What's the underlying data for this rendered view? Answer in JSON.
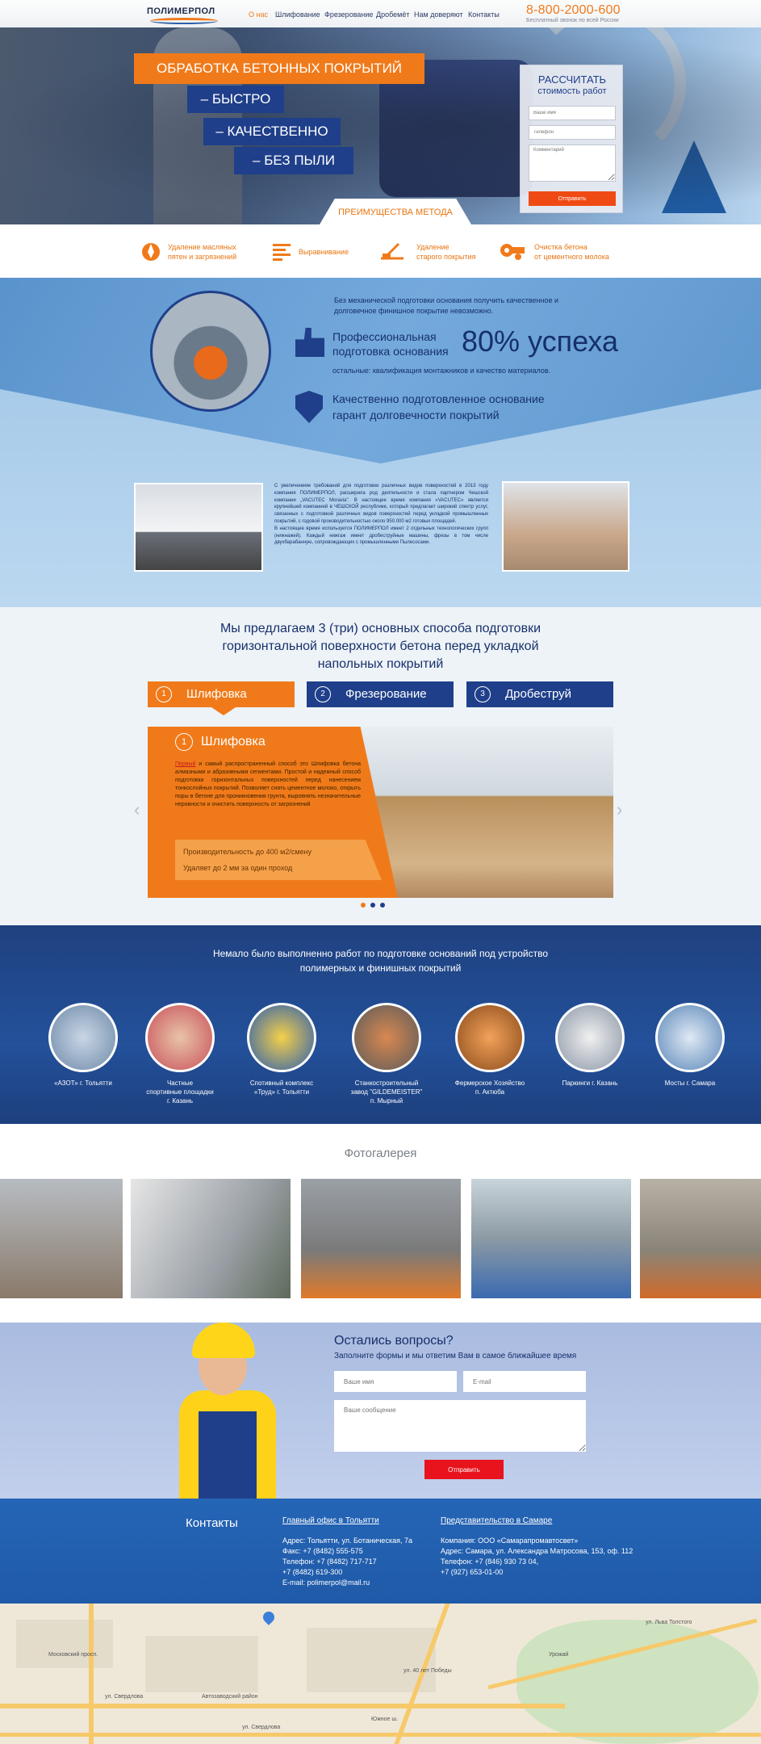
{
  "header": {
    "logo": "ПОЛИМЕРПОЛ",
    "nav": [
      "О нас",
      "Шлифование",
      "Фрезерование",
      "Дробемёт",
      "Нам доверяют",
      "Контакты"
    ],
    "phone": "8-800-2000-600",
    "phone_note": "Бесплатный звонок по всей России"
  },
  "hero": {
    "headline": "ОБРАБОТКА БЕТОННЫХ ПОКРЫТИЙ",
    "lines": [
      "– БЫСТРО",
      "– КАЧЕСТВЕННО",
      "– БЕЗ ПЫЛИ"
    ],
    "form": {
      "title": "РАССЧИТАТЬ",
      "subtitle": "стоимость работ",
      "name_placeholder": "Ваше имя",
      "phone_placeholder": "Телефон",
      "comment_placeholder": "Комментарий",
      "submit": "Отправить"
    },
    "advantages_tab": "ПРЕИМУЩЕСТВА МЕТОДА"
  },
  "features": [
    {
      "icon": "flame-icon",
      "text": "Удаление масляных\nпятен и загрязнений"
    },
    {
      "icon": "lines-icon",
      "text": "Выравнивание"
    },
    {
      "icon": "scraper-icon",
      "text": "Удаление\nстарого покрытия"
    },
    {
      "icon": "machine-icon",
      "text": "Очистка бетона\nот цементного молока"
    }
  ],
  "professional": {
    "intro": "Без механической подготовки основания получить качественное и долговечное финишное покрытие невозможно.",
    "headline": "Профессиональная\nподготовка основания",
    "percent": "80% успеха",
    "rest": "остальные: квалификация монтажников и качество материалов.",
    "guarantee": "Качественно подготовленное основание\nгарант долговечности покрытий",
    "description": "С увеличением требований для подготовки различных видов поверхностей в 2013 году компания ПОЛИМЕРПОЛ, расширила род деятельности и стала партнером Чешской компании „VACUTEC Moravia\". В настоящее время компания «VACUTEC» является крупнейшей компанией в ЧЕШСКОЙ республике, который предлагает широкий спектр услуг, связанных с подготовкой различных видов поверхностей перед укладкой промышленных покрытий, с годовой производительностью около 950.000 м2 готовых площадей.\nВ настоящее время используется ПОЛИМЕРПОЛ имеет 2 отдельных технологических групп (нижнажей). Каждый нижгаж имеет дробеструйные машины, фрезы в том числе двухбарабанную, сопровождающих с промышленными Пылесосами."
  },
  "methods": {
    "title": "Мы предлагаем 3 (три) основных способа подготовки\nгоризонтальной поверхности бетона перед укладкой\nнапольных покрытий",
    "tabs": [
      {
        "num": "1",
        "label": "Шлифовка"
      },
      {
        "num": "2",
        "label": "Фрезерование"
      },
      {
        "num": "3",
        "label": "Дробеструй"
      }
    ],
    "slide": {
      "num": "1",
      "title": "Шлифовка",
      "lead": "Первый",
      "text": " и самый распространенный способ это Шлифовка бетона алмазными и абразивными сегментами. Простой и надежный способ подготовки горизонтальных поверхностей перед нанесением тонкослойных покрытий. Позволяет снять цементное молоко, открыть поры в бетоне для проникновения грунта, выровнять незначительные неровности и очистить поверхность от загрязнений",
      "spec1": "Производительность до 400 м2/смену",
      "spec2": "Удаляет до 2 мм за один проход"
    },
    "prev": "‹",
    "next": "›"
  },
  "works": {
    "title": "Немало было выполненно работ по подготовке оснований под устройство\nполимерных и финишных покрытий",
    "items": [
      "«АЗОТ» г. Тольятти",
      "Частные\nспортивные площадки\nг. Казань",
      "Спотивный комплекс\n«Труд» г. Тольятти",
      "Станкостроительный\nзавод \"GILDEMEISTER\"\nп. Мырный",
      "Фермерское Хозяйство\nп. Актюба",
      "Паркинги г. Казань",
      "Мосты г. Самара"
    ]
  },
  "gallery": {
    "title": "Фотогалерея"
  },
  "contact": {
    "title": "Остались вопросы?",
    "subtitle": "Заполните формы  и мы ответим Вам в самое ближайшее время",
    "name_placeholder": "Ваше имя",
    "email_placeholder": "E-mail",
    "message_placeholder": "Ваше сообщение",
    "submit": "Отправить"
  },
  "footer": {
    "title": "Контакты",
    "office1": {
      "heading": "Главный офис в Тольятти",
      "lines": [
        "Адрес:  Тольятти, ул. Ботаническая, 7а",
        "Факс:    +7 (8482) 555-575",
        "Телефон:   +7 (8482) 717-717",
        "                  +7 (8482) 619-300",
        "E-mail:  polimerpol@mail.ru"
      ]
    },
    "office2": {
      "heading": "Представительство в Самаре",
      "lines": [
        "Компания: ООО «Самарапромавтосвет»",
        "Адрес:  Самара, ул. Александра Матросова, 153, оф. 112",
        "Телефон:    +7 (846) 930 73 04,",
        "                      +7 (927) 653-01-00"
      ]
    }
  },
  "map": {
    "labels": [
      "ул. Свердлова",
      "ул. Свердлова",
      "Автозаводский район",
      "ул. 40 лет Победы",
      "ул. Льва Толстого",
      "Московский просп.",
      "Южное ш.",
      "Урожай"
    ]
  }
}
